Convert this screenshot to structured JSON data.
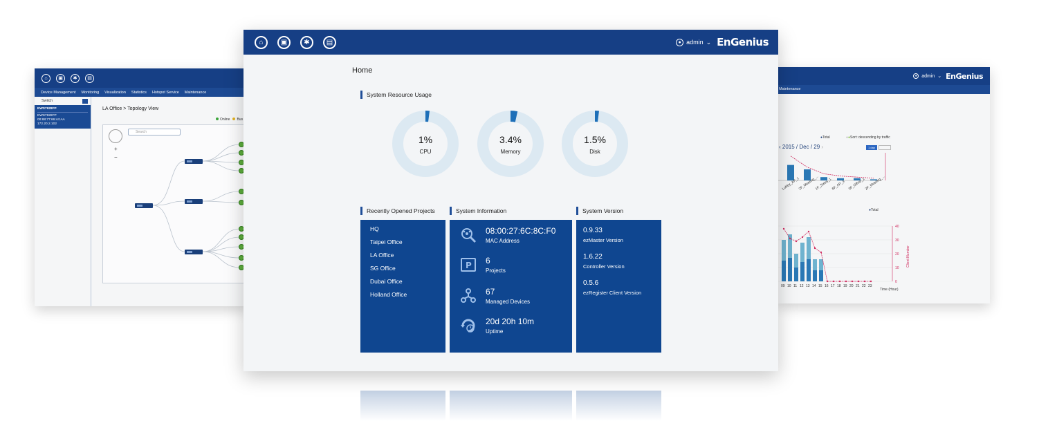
{
  "main": {
    "user": "admin",
    "brand": "EnGenius",
    "page_title": "Home",
    "resource_title": "System Resource Usage",
    "gauges": [
      {
        "value": "1%",
        "label": "CPU",
        "fraction": 0.01
      },
      {
        "value": "3.4%",
        "label": "Memory",
        "fraction": 0.034
      },
      {
        "value": "1.5%",
        "label": "Disk",
        "fraction": 0.015
      }
    ],
    "projects_title": "Recently Opened Projects",
    "projects": [
      "HQ",
      "Taipei Office",
      "LA Office",
      "SG Office",
      "Dubai Office",
      "Holland Office"
    ],
    "info_title": "System Information",
    "info": [
      {
        "icon": "search-network-icon",
        "value": "08:00:27:6C:8C:F0",
        "label": "MAC Address"
      },
      {
        "icon": "project-icon",
        "value": "6",
        "label": "Projects"
      },
      {
        "icon": "devices-icon",
        "value": "67",
        "label": "Managed Devices"
      },
      {
        "icon": "uptime-icon",
        "value": "20d 20h 10m",
        "label": "Uptime"
      }
    ],
    "version_title": "System Version",
    "versions": [
      {
        "value": "0.9.33",
        "label": "ezMaster Version"
      },
      {
        "value": "1.6.22",
        "label": "Controller Version"
      },
      {
        "value": "0.5.6",
        "label": "ezRegister Client Version"
      }
    ],
    "colors": {
      "header": "#163f85",
      "card": "#0f4690",
      "gauge_track": "#dce9f2",
      "gauge_fill": "#1d6fb8"
    }
  },
  "left": {
    "menu": [
      "Device Management",
      "Monitoring",
      "Visualization",
      "Statistics",
      "Hotspot Service",
      "Maintenance"
    ],
    "sidebar_title": "Switch",
    "device_name": "EWS7928FP",
    "device_lines": [
      "EWS7928FP",
      "00:88:77:66:44:AA",
      "172.20.2.102"
    ],
    "breadcrumb": "LA Office > Topology View",
    "legend": [
      "Online",
      "Bus"
    ],
    "search_placeholder": "Search"
  },
  "right": {
    "user": "admin",
    "brand": "EnGenius",
    "menu": "Maintenance",
    "legend_top": "Total",
    "legend_top_sort": "Sort: descending by traffic",
    "date": "2015 / Dec / 29",
    "day_button": "1 day",
    "legend_bottom": "Total",
    "y_axis_label": "Client Number",
    "x_axis_label": "Time (Hour)",
    "hours": [
      "09",
      "10",
      "11",
      "12",
      "13",
      "14",
      "15",
      "16",
      "17",
      "18",
      "19",
      "20",
      "21",
      "22",
      "23"
    ],
    "hour_bars": [
      30,
      34,
      20,
      28,
      32,
      16,
      16,
      0,
      0,
      0,
      0,
      0,
      0,
      0,
      0
    ],
    "hour_line": [
      38,
      31,
      29,
      32,
      36,
      24,
      21,
      0,
      0,
      0,
      0,
      0,
      0,
      0,
      0
    ],
    "y_ticks": [
      "40",
      "30",
      "20",
      "10",
      "0"
    ],
    "ap_labels": [
      "Lobby_AP_1",
      "2F_Meeting_...",
      "1F_Sales_1",
      "6F_AP_3",
      "3F_Office_1",
      "2F_Meeting_..."
    ],
    "ap_bars": [
      14,
      10,
      3,
      2,
      2,
      1
    ],
    "ap_line": [
      22,
      12,
      6,
      4,
      3,
      2
    ]
  }
}
